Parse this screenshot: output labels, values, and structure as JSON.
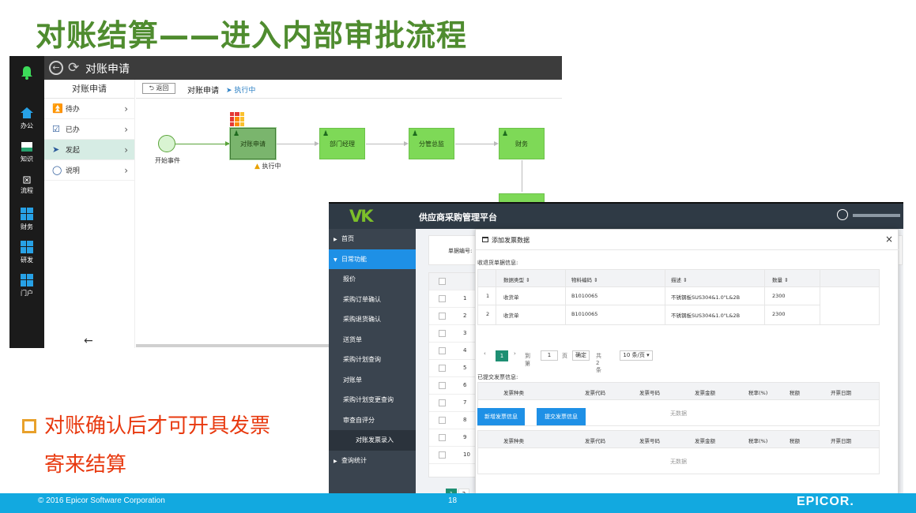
{
  "slide": {
    "title": "对账结算——进入内部审批流程",
    "bullet_line1": "对账确认后才可开具发票",
    "bullet_line2": "寄来结算"
  },
  "bpm": {
    "header_title": "对账申请",
    "rail": [
      {
        "icon": "bell-icon",
        "label": ""
      },
      {
        "icon": "home-icon",
        "label": "办公"
      },
      {
        "icon": "knowledge-icon",
        "label": "知识"
      },
      {
        "icon": "flow-icon",
        "label": "流程"
      },
      {
        "icon": "windows-icon",
        "label": "财务"
      },
      {
        "icon": "windows-icon",
        "label": "研发"
      },
      {
        "icon": "windows-icon",
        "label": "门户"
      }
    ],
    "left_title": "对账申请",
    "menu": [
      {
        "icon": "inbox-icon",
        "label": "待办"
      },
      {
        "icon": "checklist-icon",
        "label": "已办"
      },
      {
        "icon": "send-icon",
        "label": "发起"
      },
      {
        "icon": "bulb-icon",
        "label": "说明"
      }
    ],
    "toolbar": {
      "back": "返回",
      "title": "对账申请",
      "state": "执行中"
    },
    "flow": {
      "start_label": "开始事件",
      "nodes": [
        "对账申请",
        "部门经理",
        "分管总监",
        "财务"
      ],
      "exec_label": "执行中"
    },
    "colors": {
      "node": "#7ed957",
      "node_current": "#7ab56d",
      "rail": "#1b1b1b"
    }
  },
  "sp": {
    "logo": "VK",
    "title": "供应商采购管理平台",
    "sidebar": [
      {
        "label": "首页",
        "type": "top"
      },
      {
        "label": "日常功能",
        "type": "top-open"
      },
      {
        "label": "报价",
        "type": "item"
      },
      {
        "label": "采购订单确认",
        "type": "item"
      },
      {
        "label": "采购退货确认",
        "type": "item"
      },
      {
        "label": "送货单",
        "type": "item"
      },
      {
        "label": "采购计划查询",
        "type": "item"
      },
      {
        "label": "对账单",
        "type": "item"
      },
      {
        "label": "采购计划变更查询",
        "type": "item"
      },
      {
        "label": "审查自评分",
        "type": "item"
      },
      {
        "label": "对账发票录入",
        "type": "deep"
      },
      {
        "label": "查询统计",
        "type": "top"
      }
    ],
    "bg": {
      "field_label": "单据编号:",
      "row_numbers": [
        "1",
        "2",
        "3",
        "4",
        "5",
        "6",
        "7",
        "8",
        "9",
        "10"
      ],
      "pages": [
        "1",
        "2"
      ]
    },
    "modal": {
      "title": "添加发票数据",
      "close": "×",
      "section1": "收退货单据信息:",
      "t1_headers": [
        "数据类型 ⇕",
        "物料编码 ⇕",
        "描述 ⇕",
        "数量 ⇕"
      ],
      "t1_rows": [
        [
          "1",
          "收货单",
          "B1010065",
          "不锈钢板SUS304&1.0\"L&2B",
          "2300"
        ],
        [
          "2",
          "收货单",
          "B1010065",
          "不锈钢板SUS304&1.0\"L&2B",
          "2300"
        ]
      ],
      "pager": {
        "current": "1",
        "goto": "到第",
        "page_input": "1",
        "page_unit": "页",
        "confirm": "确定",
        "total": "共 2 条",
        "per_page": "10 条/页 ▾"
      },
      "section2": "已提交发票信息:",
      "inv_headers": [
        "发票种类",
        "发票代码",
        "发票号码",
        "发票金额",
        "税率(%)",
        "税额",
        "开票日期"
      ],
      "empty": "无数据",
      "btn_new": "新增发票信息",
      "btn_submit": "提交发票信息"
    }
  },
  "footer": {
    "copyright": "© 2016 Epicor Software Corporation",
    "page": "18",
    "brand": "EPICOR."
  }
}
